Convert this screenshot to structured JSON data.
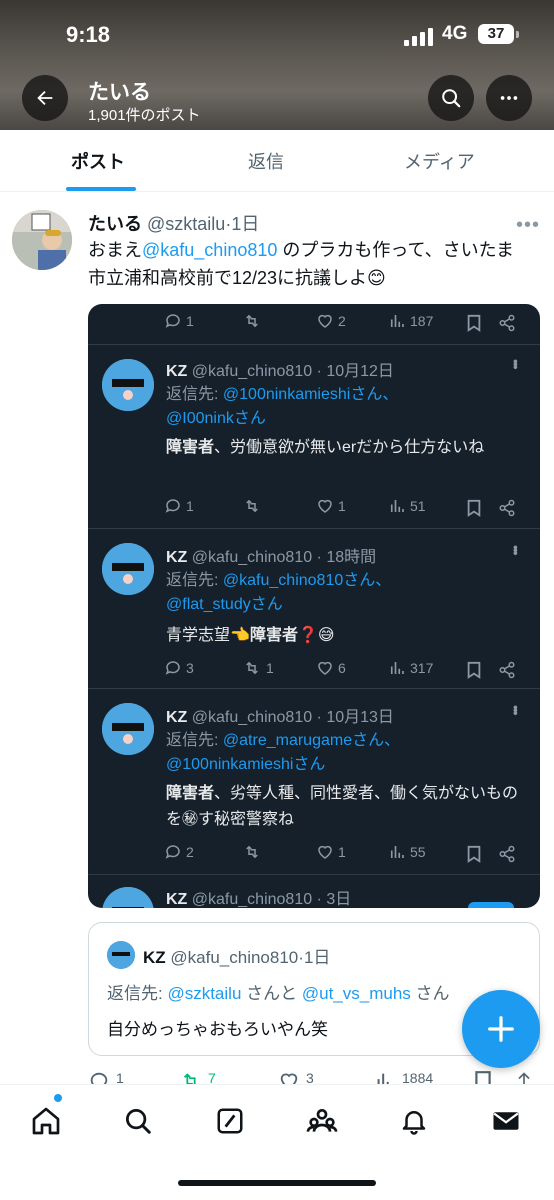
{
  "status_bar": {
    "time": "9:18",
    "network": "4G",
    "battery": "37"
  },
  "header": {
    "title": "たいる",
    "subtitle": "1,901件のポスト"
  },
  "tabs": [
    {
      "label": "ポスト",
      "active": true
    },
    {
      "label": "返信",
      "active": false
    },
    {
      "label": "メディア",
      "active": false
    }
  ],
  "tweet": {
    "name": "たいる",
    "handle": "@szktailu",
    "time": "1日",
    "text_pre": "おまえ",
    "mention": "@kafu_chino810",
    "text_post": " のプラカも作って、さいたま市立浦和高校前で12/23に抗議しよ😊"
  },
  "image": {
    "top_actions": {
      "replies": "1",
      "retweets": "",
      "likes": "2",
      "views": "187"
    },
    "replies": [
      {
        "name": "KZ",
        "handle": "@kafu_chino810",
        "time": "10月12日",
        "reply_label": "返信先: ",
        "reply_to_1": "@100ninkamieshiさん、",
        "reply_to_2": "@I00ninkさん",
        "text_bold": "障害者",
        "text": "、労働意欲が無いerだから仕方ないね",
        "actions": {
          "replies": "1",
          "retweets": "",
          "likes": "1",
          "views": "51"
        }
      },
      {
        "name": "KZ",
        "handle": "@kafu_chino810",
        "time": "18時間",
        "reply_label": "返信先: ",
        "reply_to_1": "@kafu_chino810さん、",
        "reply_to_2": "@flat_studyさん",
        "text_pre": "青学志望👈",
        "text_bold": "障害者",
        "text": "❓😅",
        "actions": {
          "replies": "3",
          "retweets": "1",
          "likes": "6",
          "views": "317"
        }
      },
      {
        "name": "KZ",
        "handle": "@kafu_chino810",
        "time": "10月13日",
        "reply_label": "返信先: ",
        "reply_to_1": "@atre_marugameさん、",
        "reply_to_2": "@100ninkamieshiさん",
        "text_bold": "障害者",
        "text": "、劣等人種、同性愛者、働く気がないものを㊙す秘密警察ね",
        "actions": {
          "replies": "2",
          "retweets": "",
          "likes": "1",
          "views": "55"
        }
      },
      {
        "name": "KZ",
        "handle": "@kafu_chino810",
        "time": "3日"
      }
    ]
  },
  "quote": {
    "name": "KZ",
    "handle": "@kafu_chino810",
    "time": "1日",
    "reply_label": "返信先: ",
    "reply_to_1": "@szktailu",
    "reply_and": " さんと ",
    "reply_to_2": "@ut_vs_muhs",
    "reply_suffix": " さん",
    "text": "自分めっちゃおもろいやん笑"
  },
  "bottom_actions": {
    "replies": "1",
    "retweets": "7",
    "likes": "3",
    "views": "1884"
  },
  "colors": {
    "accent": "#1d9bf0",
    "dark_bg": "#15202b",
    "retweet_green": "#00ba7c"
  }
}
